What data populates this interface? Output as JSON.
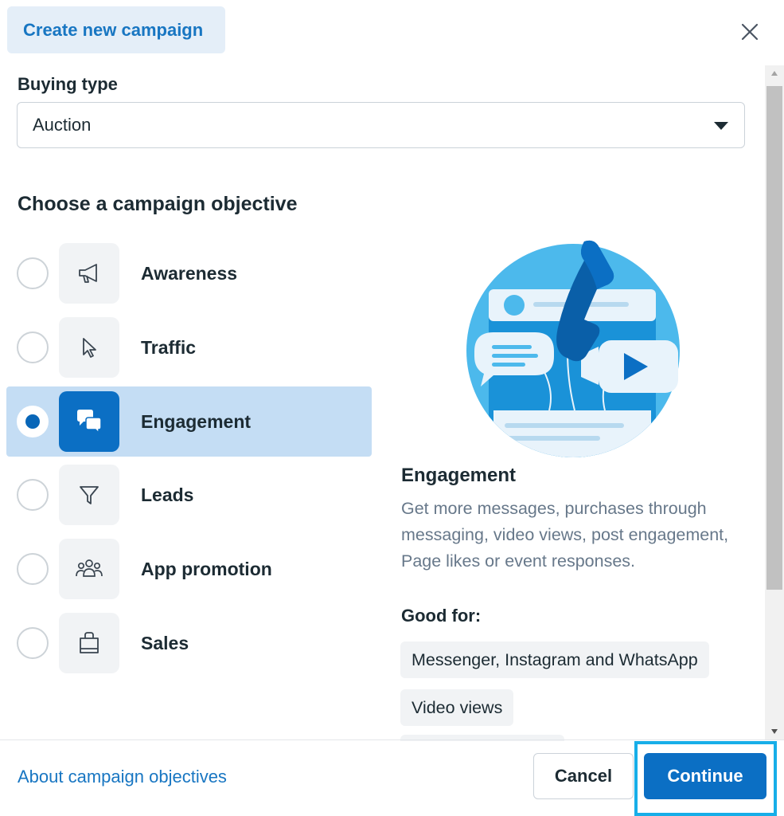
{
  "header": {
    "title": "Create new campaign",
    "close_icon": "close-icon"
  },
  "buying_type": {
    "label": "Buying type",
    "value": "Auction"
  },
  "objective_section": {
    "title": "Choose a campaign objective",
    "items": [
      {
        "label": "Awareness",
        "icon": "megaphone-icon",
        "selected": false
      },
      {
        "label": "Traffic",
        "icon": "cursor-icon",
        "selected": false
      },
      {
        "label": "Engagement",
        "icon": "chat-bubbles-icon",
        "selected": true
      },
      {
        "label": "Leads",
        "icon": "filter-icon",
        "selected": false
      },
      {
        "label": "App promotion",
        "icon": "people-icon",
        "selected": false
      },
      {
        "label": "Sales",
        "icon": "shopping-bag-icon",
        "selected": false
      }
    ]
  },
  "description": {
    "title": "Engagement",
    "text": "Get more messages, purchases through messaging, video views, post engagement, Page likes or event responses.",
    "good_for_label": "Good for:",
    "good_for": [
      "Messenger, Instagram and WhatsApp",
      "Video views"
    ]
  },
  "footer": {
    "link": "About campaign objectives",
    "cancel": "Cancel",
    "continue": "Continue"
  },
  "colors": {
    "accent": "#0b6fc4",
    "selected_bg": "#c4ddf4",
    "link": "#1876c2",
    "highlight_border": "#17aee8"
  }
}
